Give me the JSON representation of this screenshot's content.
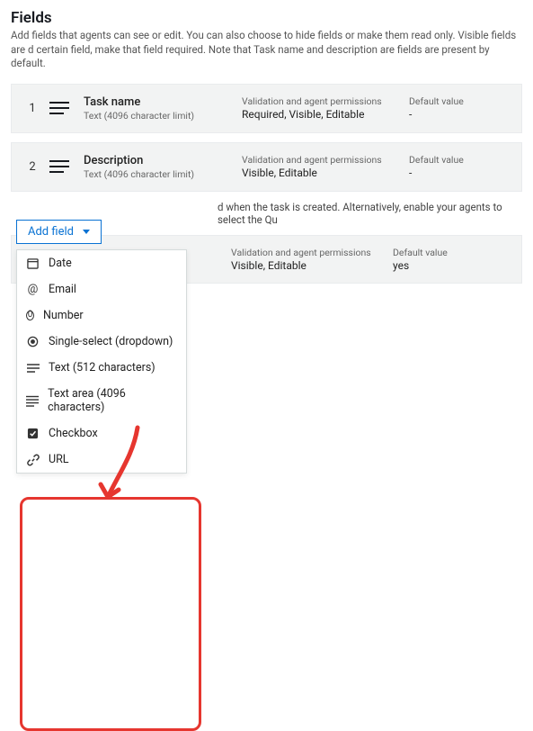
{
  "section": {
    "title": "Fields",
    "description": "Add fields that agents can see or edit. You can also choose to hide fields or make them read only. Visible fields are d certain field, make that field required. Note that Task name and description are fields are present by default."
  },
  "columns": {
    "validation_label": "Validation and agent permissions",
    "default_label": "Default value"
  },
  "fields": [
    {
      "index": "1",
      "name": "Task name",
      "sub": "Text (4096 character limit)",
      "validation": "Required, Visible, Editable",
      "default": "-"
    },
    {
      "index": "2",
      "name": "Description",
      "sub": "Text (4096 character limit)",
      "validation": "Visible, Editable",
      "default": "-"
    }
  ],
  "body_text_partial": "d when the task is created. Alternatively, enable your agents to select the Qu",
  "partial_row": {
    "validation": "Visible, Editable",
    "default": "yes"
  },
  "addfield": {
    "button_label": "Add field",
    "options": [
      {
        "icon": "calendar",
        "label": "Date"
      },
      {
        "icon": "at",
        "label": "Email"
      },
      {
        "icon": "zero",
        "label": "Number"
      },
      {
        "icon": "radio",
        "label": "Single-select (dropdown)"
      },
      {
        "icon": "lines-short",
        "label": "Text (512 characters)"
      },
      {
        "icon": "lines-long",
        "label": "Text area (4096 characters)"
      },
      {
        "icon": "checkbox",
        "label": "Checkbox"
      },
      {
        "icon": "link",
        "label": "URL"
      }
    ]
  },
  "annotation": {
    "color": "#e6362f"
  }
}
